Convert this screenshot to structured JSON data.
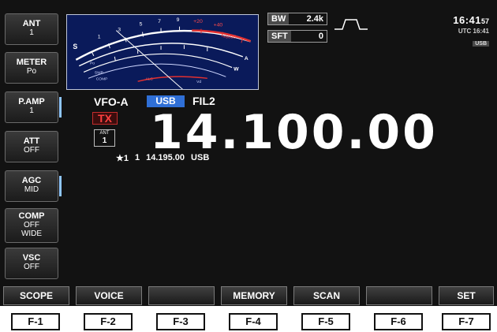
{
  "side_keys": [
    {
      "title": "ANT",
      "value": "1"
    },
    {
      "title": "METER",
      "value": "Po"
    },
    {
      "title": "P.AMP",
      "value": "1"
    },
    {
      "title": "ATT",
      "value": "OFF"
    },
    {
      "title": "AGC",
      "value": "MID"
    },
    {
      "title": "COMP",
      "value": "OFF",
      "value2": "WIDE"
    },
    {
      "title": "VSC",
      "value": "OFF"
    }
  ],
  "meter": {
    "s_scale": [
      "S",
      "1",
      "3",
      "5",
      "7",
      "9",
      "+20",
      "+40",
      "+60dB"
    ],
    "labels": [
      "A",
      "W",
      "SWR",
      "COMP",
      "ALC",
      "Po",
      "Vd"
    ]
  },
  "bw": {
    "label": "BW",
    "value": "2.4k"
  },
  "sft": {
    "label": "SFT",
    "value": "0"
  },
  "clock": {
    "time": "16:41",
    "seconds": "57",
    "utc": "UTC 16:41",
    "tag": "USB"
  },
  "vfo": {
    "name": "VFO-A",
    "mode": "USB",
    "filter": "FIL2"
  },
  "tx": "TX",
  "antenna": {
    "label": "ANT",
    "number": "1"
  },
  "frequency": "14.100.00",
  "memo": {
    "mark": "★1",
    "slot": "1",
    "frequency": "14.195.00",
    "mode": "USB"
  },
  "bottom_keys": [
    "SCOPE",
    "VOICE",
    "",
    "MEMORY",
    "SCAN",
    "",
    "SET"
  ],
  "function_keys": [
    "F-1",
    "F-2",
    "F-3",
    "F-4",
    "F-5",
    "F-6",
    "F-7"
  ],
  "colors": {
    "accent": "#2f6fd6",
    "tx": "#ff4040",
    "meter_bg": "#0a1a5a"
  }
}
